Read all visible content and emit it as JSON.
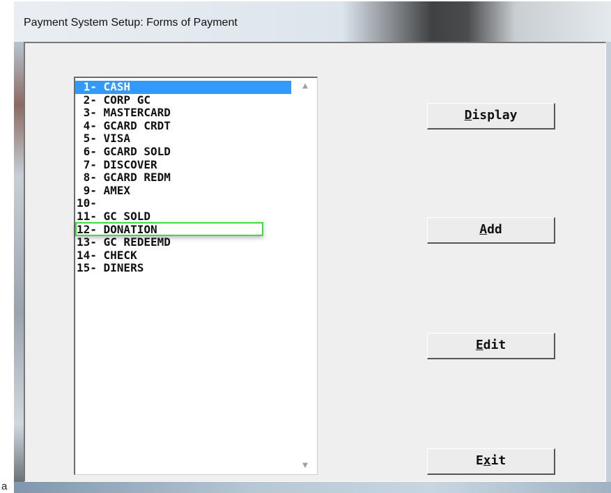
{
  "window": {
    "title": "Payment System Setup:  Forms of Payment"
  },
  "list": {
    "items": [
      {
        "label": " 1- CASH",
        "selected": true
      },
      {
        "label": " 2- CORP GC"
      },
      {
        "label": " 3- MASTERCARD"
      },
      {
        "label": " 4- GCARD CRDT"
      },
      {
        "label": " 5- VISA"
      },
      {
        "label": " 6- GCARD SOLD"
      },
      {
        "label": " 7- DISCOVER"
      },
      {
        "label": " 8- GCARD REDM"
      },
      {
        "label": " 9- AMEX"
      },
      {
        "label": "10-"
      },
      {
        "label": "11- GC SOLD"
      },
      {
        "label": "12- DONATION",
        "highlighted": true
      },
      {
        "label": "13- GC REDEEMD"
      },
      {
        "label": "14- CHECK"
      },
      {
        "label": "15- DINERS"
      }
    ]
  },
  "buttons": {
    "display": {
      "accel": "D",
      "rest": "isplay"
    },
    "add": {
      "accel": "A",
      "rest": "dd"
    },
    "edit": {
      "accel": "E",
      "rest": "dit"
    },
    "exit": {
      "pre": "E",
      "accel": "x",
      "rest": "it"
    }
  },
  "corner_text": "a",
  "colors": {
    "selection": "#3399ff",
    "highlight_box": "#3fdc3f",
    "client_bg": "#efefef"
  },
  "icons": {
    "scroll_up": "scroll-up-arrow-icon",
    "scroll_down": "scroll-down-arrow-icon"
  }
}
